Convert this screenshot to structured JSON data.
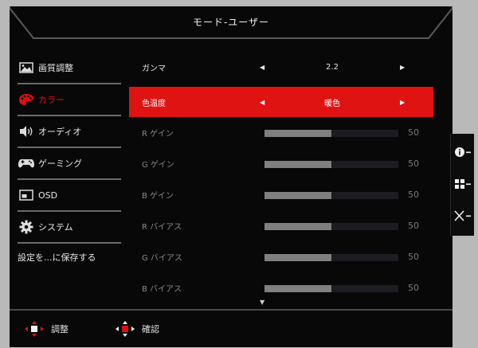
{
  "header": {
    "title": "モード-ユーザー"
  },
  "sidebar": {
    "items": [
      {
        "label": "画質調整",
        "icon": "picture-icon"
      },
      {
        "label": "カラー",
        "icon": "palette-icon",
        "active": true
      },
      {
        "label": "オーディオ",
        "icon": "speaker-icon"
      },
      {
        "label": "ゲーミング",
        "icon": "gamepad-icon"
      },
      {
        "label": "OSD",
        "icon": "osd-icon"
      },
      {
        "label": "システム",
        "icon": "gear-icon"
      },
      {
        "label": "設定を...に保存する",
        "icon": ""
      }
    ]
  },
  "settings": {
    "gamma": {
      "label": "ガンマ",
      "value": "2.2"
    },
    "color_temp": {
      "label": "色温度",
      "value": "暖色"
    },
    "r_gain": {
      "label": "R ゲイン",
      "value": "50"
    },
    "g_gain": {
      "label": "G ゲイン",
      "value": "50"
    },
    "b_gain": {
      "label": "B ゲイン",
      "value": "50"
    },
    "r_bias": {
      "label": "R バイアス",
      "value": "50"
    },
    "g_bias": {
      "label": "G バイアス",
      "value": "50"
    },
    "b_bias": {
      "label": "B バイアス",
      "value": "50"
    },
    "slider_max": 100
  },
  "footer": {
    "adjust_label": "調整",
    "confirm_label": "確認"
  },
  "side_panel": {
    "info_glyph": "i",
    "menu_glyph": "▦",
    "close_glyph": "×",
    "suffix": "-"
  },
  "colors": {
    "accent": "#e01313",
    "background": "#080808",
    "panel": "#b9b9b9"
  }
}
